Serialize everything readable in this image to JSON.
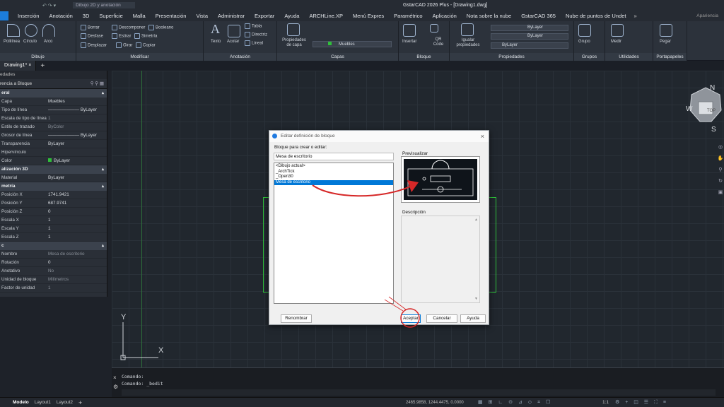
{
  "titlebar": {
    "workspace": "Dibujo 2D y anotación",
    "title": "GstarCAD 2026 Plus - [Drawing1.dwg]",
    "appearance": "Apariencia"
  },
  "menu": {
    "app_label": "o",
    "tabs": [
      "Inserción",
      "Anotación",
      "3D",
      "Superficie",
      "Malla",
      "Presentación",
      "Vista",
      "Administrar",
      "Exportar",
      "Ayuda",
      "ARCHLine.XP",
      "Menú Expres",
      "Paramétrico",
      "Aplicación",
      "Nota sobre la nube",
      "GstarCAD 365",
      "Nube de puntos de Undet"
    ]
  },
  "ribbon": {
    "dibujo": {
      "title": "Dibujo",
      "items": [
        "Polilínea",
        "Círculo",
        "Arco"
      ]
    },
    "modificar": {
      "title": "Modificar",
      "items": [
        "Borrar",
        "Descomponer",
        "Booleano",
        "Desfase",
        "Estirar",
        "Simetría",
        "Desplazar",
        "Girar",
        "Copiar"
      ]
    },
    "anotacion": {
      "title": "Anotación",
      "items": [
        "Texto",
        "Acotar",
        "Tabla",
        "Directriz",
        "Lineal"
      ]
    },
    "capas": {
      "title": "Capas",
      "items": [
        "Propiedades de capa"
      ],
      "layer": "Muebles"
    },
    "bloque": {
      "title": "Bloque",
      "items": [
        "Insertar",
        "QR Code"
      ]
    },
    "propiedades": {
      "title": "Propiedades",
      "items": [
        "Igualar propiedades"
      ],
      "bylayer": [
        "ByLayer",
        "ByLayer",
        "ByLayer"
      ]
    },
    "grupos": {
      "title": "Grupos",
      "items": [
        "Grupo"
      ]
    },
    "utilidades": {
      "title": "Utilidades",
      "items": [
        "Medir"
      ]
    },
    "portapapeles": {
      "title": "Portapapeles",
      "items": [
        "Pegar"
      ]
    }
  },
  "doctabs": {
    "active": "Drawing1*"
  },
  "props": {
    "title": "edades",
    "selector": "rencia a Bloque",
    "sections": [
      {
        "head": "eral",
        "rows": [
          [
            "Capa",
            "Muebles",
            ""
          ],
          [
            "Tipo de línea",
            "——————— ByLayer",
            ""
          ],
          [
            "Escala de tipo de línea",
            "1",
            "dim"
          ],
          [
            "Estilo de trazado",
            "ByColor",
            "dim"
          ],
          [
            "Grosor de línea",
            "——————— ByLayer",
            ""
          ],
          [
            "Transparencia",
            "ByLayer",
            ""
          ],
          [
            "Hipervínculo",
            "",
            ""
          ],
          [
            "Color",
            "ByLayer",
            "color"
          ]
        ]
      },
      {
        "head": "alización 3D",
        "rows": [
          [
            "Material",
            "ByLayer",
            ""
          ]
        ]
      },
      {
        "head": "metría",
        "rows": [
          [
            "Posición X",
            "1741.9421",
            ""
          ],
          [
            "Posición Y",
            "687.9741",
            ""
          ],
          [
            "Posición Z",
            "0",
            ""
          ],
          [
            "Escala X",
            "1",
            ""
          ],
          [
            "Escala Y",
            "1",
            ""
          ],
          [
            "Escala Z",
            "1",
            ""
          ]
        ]
      },
      {
        "head": "c",
        "rows": [
          [
            "Nombre",
            "Mesa de escritorio",
            "dim"
          ],
          [
            "Rotación",
            "0",
            ""
          ],
          [
            "Anotativo",
            "No",
            "dim"
          ],
          [
            "Unidad de bloque",
            "Milímetros",
            "dim"
          ],
          [
            "Factor de unidad",
            "1",
            "dim"
          ]
        ]
      }
    ]
  },
  "compass": {
    "n": "N",
    "w": "W",
    "s": "S",
    "top": "TOP"
  },
  "ucs": {
    "x": "X",
    "y": "Y"
  },
  "cmd": {
    "lines": [
      "Comando:",
      "Comando: _bedit"
    ]
  },
  "status": {
    "tabs": [
      "Modelo",
      "Layout1",
      "Layout2"
    ],
    "coords": "2465.9858, 1244.4475, 0.0000",
    "scale": "1:1"
  },
  "dialog": {
    "title": "Editar definición de bloque",
    "label": "Bloque para crear o editar:",
    "input": "Mesa de escritorio",
    "list": [
      "<Dibujo actual>",
      "_ArchTick",
      "_Open30",
      "Mesa de escritorio"
    ],
    "selected_index": 3,
    "preview_label": "Previsualizar",
    "description_label": "Descripción",
    "buttons": {
      "rename": "Renombrar",
      "ok": "Aceptar",
      "cancel": "Cancelar",
      "help": "Ayuda"
    }
  },
  "colors": {
    "accent": "#0078d7",
    "annotation": "#d62828",
    "green": "#2fbf3a"
  }
}
